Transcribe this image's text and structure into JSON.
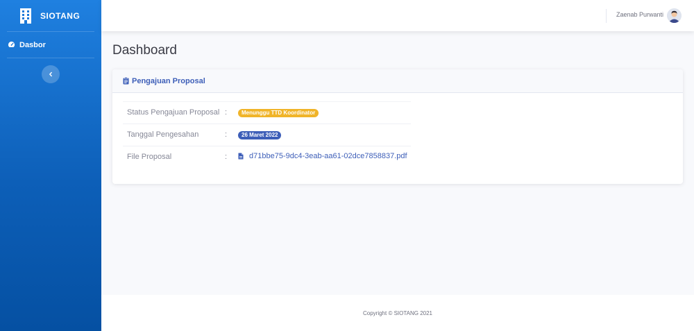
{
  "brand": {
    "name": "SIOTANG",
    "icon": "building-icon"
  },
  "sidebar": {
    "items": [
      {
        "label": "Dasbor",
        "icon": "tachometer-icon",
        "active": true
      }
    ],
    "toggle_icon": "chevron-left-icon"
  },
  "topbar": {
    "user_name": "Zaenab Purwanti",
    "avatar_icon": "user-avatar-icon"
  },
  "page": {
    "title": "Dashboard"
  },
  "card": {
    "title": "Pengajuan Proposal",
    "icon": "clipboard-icon",
    "rows": [
      {
        "label": "Status Pengajuan Proposal",
        "colon": ":",
        "value": "Menunggu TTD Koordinator",
        "type": "badge",
        "color": "#f0b429"
      },
      {
        "label": "Tanggal Pengesahan",
        "colon": ":",
        "value": "26 Maret 2022",
        "type": "badge",
        "color": "#3d5eb8"
      },
      {
        "label": "File Proposal",
        "colon": ":",
        "value": "d71bbe75-9dc4-3eab-aa61-02dce7858837.pdf",
        "type": "file-link",
        "icon": "file-icon"
      }
    ]
  },
  "footer": {
    "copyright": "Copyright © SIOTANG 2021"
  },
  "colors": {
    "sidebar_top": "#1f80e0",
    "sidebar_bottom": "#0550a2",
    "primary": "#3d5eb8",
    "warning": "#f0b429"
  }
}
